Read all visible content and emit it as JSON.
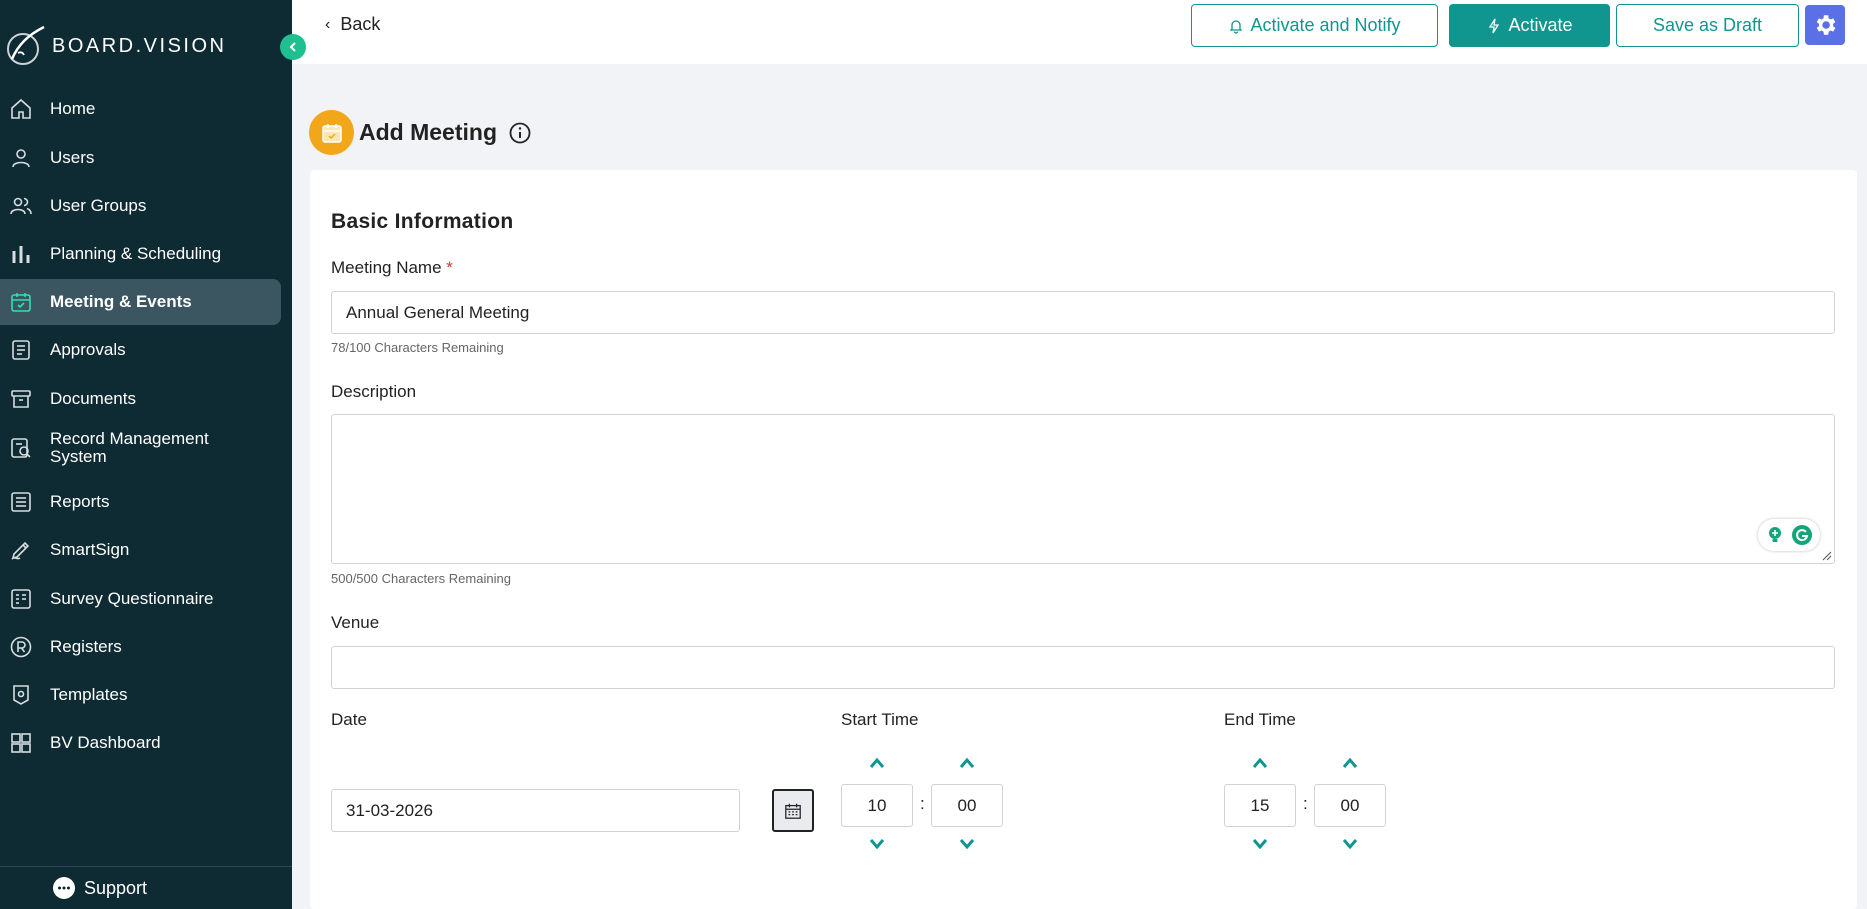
{
  "brand": {
    "name": "BOARD.VISION"
  },
  "sidebar": {
    "items": [
      {
        "label": "Home",
        "icon": "home-icon"
      },
      {
        "label": "Users",
        "icon": "user-icon"
      },
      {
        "label": "User Groups",
        "icon": "user-groups-icon"
      },
      {
        "label": "Planning & Scheduling",
        "icon": "bar-chart-icon"
      },
      {
        "label": "Meeting & Events",
        "icon": "calendar-check-icon",
        "active": true
      },
      {
        "label": "Approvals",
        "icon": "approvals-icon"
      },
      {
        "label": "Documents",
        "icon": "archive-icon"
      },
      {
        "label": "Record Management System",
        "icon": "record-search-icon"
      },
      {
        "label": "Reports",
        "icon": "list-icon"
      },
      {
        "label": "SmartSign",
        "icon": "pen-icon"
      },
      {
        "label": "Survey Questionnaire",
        "icon": "survey-icon"
      },
      {
        "label": "Registers",
        "icon": "registered-icon"
      },
      {
        "label": "Templates",
        "icon": "template-icon"
      },
      {
        "label": "BV Dashboard",
        "icon": "dashboard-icon"
      }
    ],
    "support_label": "Support"
  },
  "topbar": {
    "back_label": "Back",
    "activate_notify_label": "Activate and Notify",
    "activate_label": "Activate",
    "save_draft_label": "Save as Draft"
  },
  "page": {
    "title": "Add Meeting"
  },
  "form": {
    "section_title": "Basic Information",
    "meeting_name_label": "Meeting Name",
    "required_mark": "*",
    "meeting_name_value": "Annual General Meeting",
    "meeting_name_hint": "78/100 Characters Remaining",
    "description_label": "Description",
    "description_value": "",
    "description_hint": "500/500 Characters Remaining",
    "venue_label": "Venue",
    "venue_value": "",
    "date_label": "Date",
    "date_value": "31-03-2026",
    "start_time_label": "Start Time",
    "start_hour": "10",
    "start_minute": "00",
    "end_time_label": "End Time",
    "end_hour": "15",
    "end_minute": "00",
    "time_separator": ":"
  },
  "colors": {
    "sidebar_bg": "#0e2a33",
    "accent": "#11958f",
    "active_icon": "#2fe0b0",
    "settings_bg": "#5b6fe6",
    "meeting_icon_bg": "#f2a71b"
  }
}
